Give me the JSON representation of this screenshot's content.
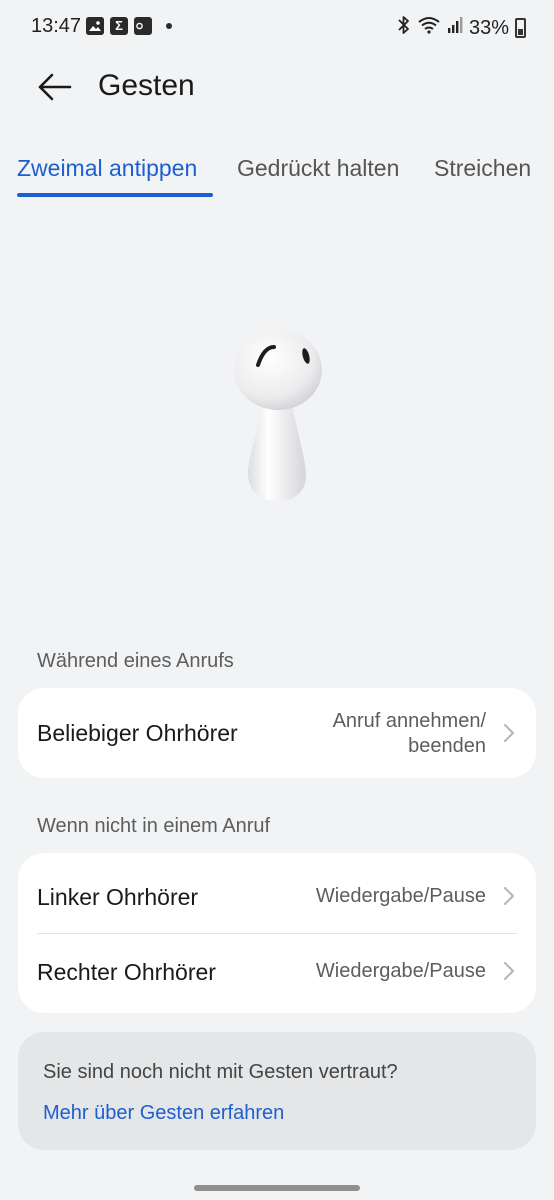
{
  "status_bar": {
    "time": "13:47",
    "battery": "33%",
    "icons": [
      "gallery-icon",
      "sigma-icon",
      "outlook-icon",
      "notification-dot",
      "bluetooth-icon",
      "wifi-icon",
      "signal-icon",
      "battery-icon"
    ]
  },
  "header": {
    "title": "Gesten"
  },
  "tabs": [
    {
      "label": "Zweimal antippen",
      "active": true
    },
    {
      "label": "Gedrückt halten",
      "active": false
    },
    {
      "label": "Streichen",
      "active": false
    }
  ],
  "sections": {
    "during_call": {
      "label": "Während eines Anrufs",
      "rows": [
        {
          "label": "Beliebiger Ohrhörer",
          "value_line1": "Anruf annehmen/",
          "value_line2": "beenden"
        }
      ]
    },
    "not_in_call": {
      "label": "Wenn nicht in einem Anruf",
      "rows": [
        {
          "label": "Linker Ohrhörer",
          "value": "Wiedergabe/Pause"
        },
        {
          "label": "Rechter Ohrhörer",
          "value": "Wiedergabe/Pause"
        }
      ]
    }
  },
  "info": {
    "text": "Sie sind noch nicht mit Gesten vertraut?",
    "link": "Mehr über Gesten erfahren"
  },
  "colors": {
    "accent": "#1e5fd0",
    "background": "#f1f3f5",
    "card": "#ffffff",
    "info_card": "#e4e6e8"
  }
}
